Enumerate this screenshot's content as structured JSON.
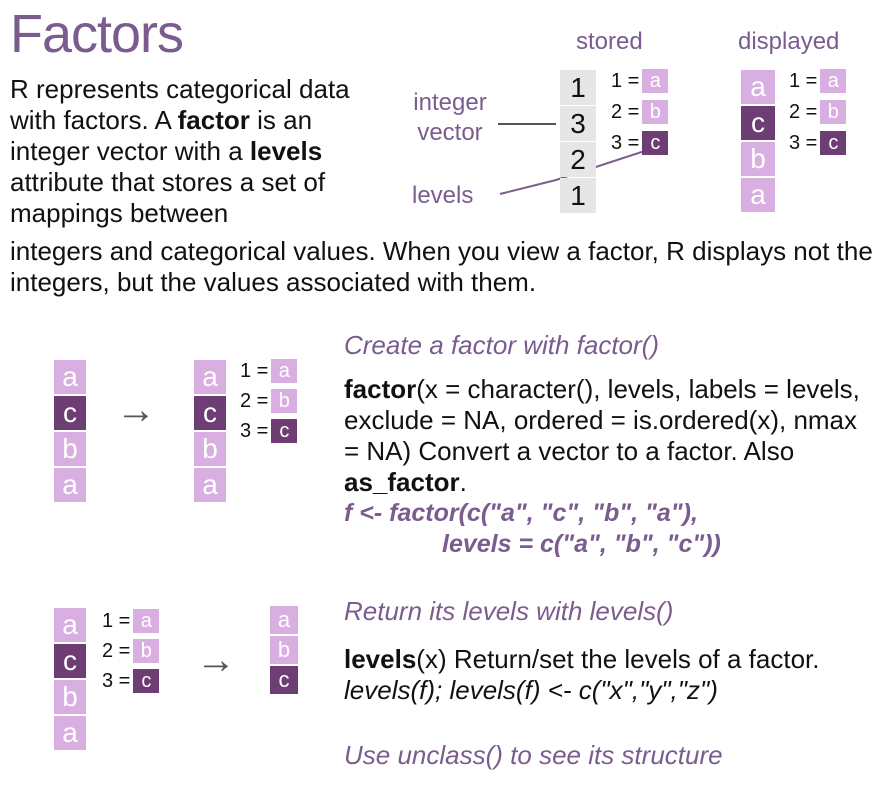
{
  "title": "Factors",
  "intro": {
    "p1": "R represents categorical data with factors. A ",
    "b1": "factor",
    "p2": " is an integer vector with a ",
    "b2": "levels",
    "p3": " attribute that stores a set of mappings between",
    "p4": "integers and categorical values. When you view a factor, R displays not the integers, but the values associated with them."
  },
  "diagram": {
    "stored_label": "stored",
    "displayed_label": "displayed",
    "integer_vector_label": "integer vector",
    "levels_label": "levels",
    "integers": [
      "1",
      "3",
      "2",
      "1"
    ],
    "displayed_values": [
      "a",
      "c",
      "b",
      "a"
    ],
    "mappings": [
      {
        "num": "1 =",
        "val": "a"
      },
      {
        "num": "2 =",
        "val": "b"
      },
      {
        "num": "3 =",
        "val": "c"
      }
    ]
  },
  "create": {
    "title": "Create a factor with factor()",
    "fn": "factor",
    "desc1": "(x = character(), levels, labels = levels, exclude = NA, ordered = is.ordered(x), nmax = NA) Convert a vector to a factor. Also ",
    "fn2": "as_factor",
    "desc2": ".",
    "code1": "f <- factor(c(\"a\", \"c\", \"b\", \"a\"),",
    "code2": "levels = c(\"a\", \"b\", \"c\"))",
    "input": [
      "a",
      "c",
      "b",
      "a"
    ],
    "output": [
      "a",
      "c",
      "b",
      "a"
    ],
    "arrow": "→"
  },
  "levels": {
    "title": "Return its levels with levels()",
    "fn": "levels",
    "desc1": "(x) Return/set the levels of a factor. ",
    "desc2": "levels(f); levels(f) <- c(\"x\",\"y\",\"z\")",
    "input": [
      "a",
      "c",
      "b",
      "a"
    ],
    "output": [
      "a",
      "b",
      "c"
    ],
    "arrow": "→"
  },
  "unclass": {
    "title": "Use unclass() to see its structure"
  },
  "colors": {
    "accent": "#7a5c8f",
    "light": "#d9aee0",
    "dark": "#6d3d73"
  }
}
